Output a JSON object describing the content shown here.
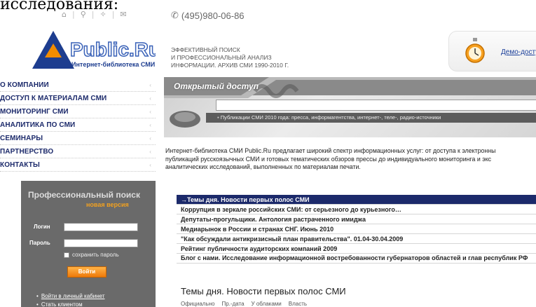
{
  "page_top_text": "исследования:",
  "header": {
    "phone": "(495)980-06-86",
    "tagline_lines": [
      "ЭФФЕКТИВНЫЙ ПОИСК",
      "И ПРОФЕССИОНАЛЬНЫЙ АНАЛИЗ",
      "ИНФОРМАЦИИ. АРХИВ СМИ 1990-2010 г."
    ],
    "demo_link": "Демо-доступ",
    "top_icons": [
      "home-icon",
      "search-icon",
      "sitemap-icon",
      "mail-icon"
    ]
  },
  "logo": {
    "brand": "Public.Ru",
    "subtitle": "Интернет-библиотека СМИ",
    "colors": {
      "triangle": "#1d3d8f",
      "accent": "#f28c00",
      "text": "#3a62b8"
    }
  },
  "nav": {
    "items": [
      "О КОМПАНИИ",
      "ДОСТУП К МАТЕРИАЛАМ СМИ",
      "МОНИТОРИНГ СМИ",
      "АНАЛИТИКА ПО СМИ",
      "СЕМИНАРЫ",
      "ПАРТНЕРСТВО",
      "КОНТАКТЫ"
    ]
  },
  "login": {
    "title": "Профессиональный поиск",
    "subtitle": "новая версия",
    "login_label": "Логин",
    "password_label": "Пароль",
    "remember_label": "сохранить пароль",
    "submit_label": "Войти",
    "links": [
      "Войти в личный кабинет",
      "Стать клиентом"
    ]
  },
  "banner": {
    "title": "Открытый доступ",
    "note": "Публикации СМИ 2010 года: пресса, информагентства, интернет-, теле-, радио-источники"
  },
  "intro_lines": [
    "Интернет-библиотека СМИ Public.Ru предлагает широкий спектр информационных услуг: от доступа к электронны",
    "публикаций русскоязычных СМИ и готовых тематических обзоров прессы до индивидуального мониторинга и экс",
    "аналитических исследований, выполненных по материалам печати."
  ],
  "topics": [
    "→Темы дня. Новости первых полос СМИ",
    "Коррупция в зеркале российских СМИ: от серьезного до курьезного…",
    "Депутаты-прогульщики. Антология растраченного имиджа",
    "Медиарынок в России и странах СНГ. Июнь 2010",
    "\"Как обсуждали антикризисный план правительства\". 01.04-30.04.2009",
    "Рейтинг публичности аудиторских компаний 2009",
    "Блог с нами. Исследование информационной востребованности губернаторов областей и глав республик РФ"
  ],
  "section": {
    "title": "Темы дня. Новости первых полос СМИ",
    "tabs": [
      "Официально",
      "Пр.-дата",
      "У облаками",
      "Власть"
    ]
  }
}
